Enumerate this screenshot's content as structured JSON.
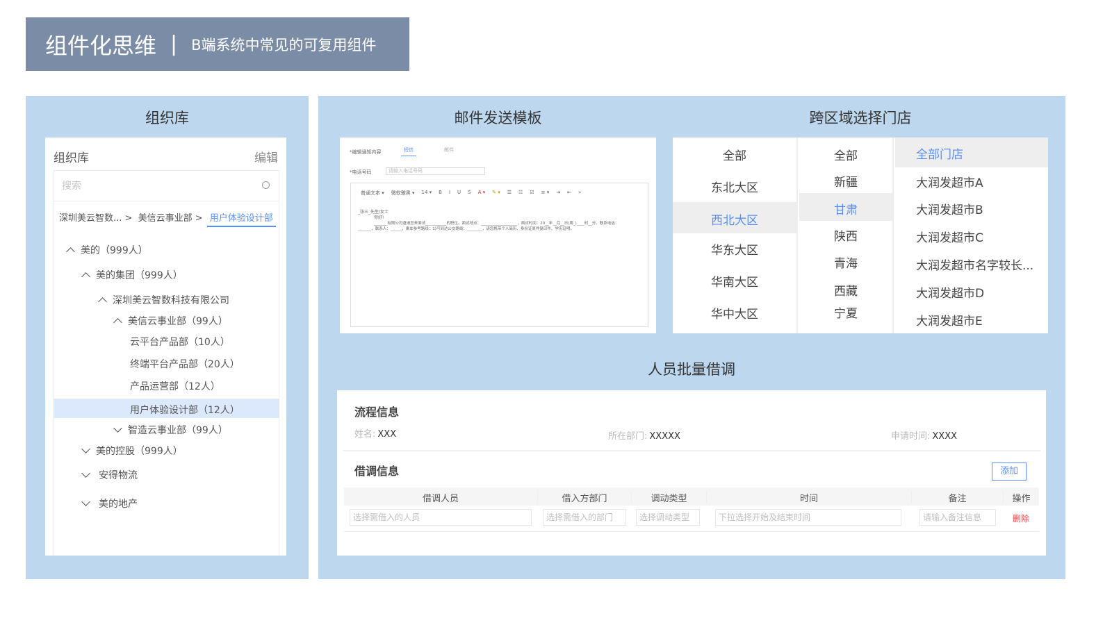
{
  "header": {
    "title": "组件化思维",
    "separator": "|",
    "subtitle": "B端系统中常见的可复用组件"
  },
  "org": {
    "section_title": "组织库",
    "card_title": "组织库",
    "edit_label": "编辑",
    "search_placeholder": "搜索",
    "breadcrumb": [
      "深圳美云智数...",
      "美信云事业部",
      "用户体验设计部"
    ],
    "tree": [
      {
        "label": "美的（999人）",
        "state": "expanded"
      },
      {
        "label": "美的集团（999人）",
        "state": "expanded"
      },
      {
        "label": "深圳美云智数科技有限公司",
        "state": "expanded"
      },
      {
        "label": "美信云事业部（99人）",
        "state": "expanded"
      },
      {
        "label": "云平台产品部（10人）",
        "state": "leaf"
      },
      {
        "label": "终端平台产品部（20人）",
        "state": "leaf"
      },
      {
        "label": "产品运营部（12人）",
        "state": "leaf"
      },
      {
        "label": "用户体验设计部（12人）",
        "state": "selected"
      },
      {
        "label": "智造云事业部（99人）",
        "state": "collapsed"
      },
      {
        "label": "美的控股（999人）",
        "state": "collapsed"
      },
      {
        "label": "安得物流",
        "state": "collapsed"
      },
      {
        "label": "美的地产",
        "state": "collapsed"
      }
    ]
  },
  "email": {
    "section_title": "邮件发送模板",
    "content_label": "*编辑通知内容",
    "tabs": [
      "短信",
      "邮件"
    ],
    "phone_label": "*电话号码",
    "phone_placeholder": "请输入电话号码",
    "toolbar": [
      "普通文本 ▾",
      "微软雅黑 ▾",
      "14 ▾",
      "B",
      "I",
      "U",
      "S",
      "A ▾",
      "✎ ▾",
      "☰",
      "☷",
      "☑",
      "≡ ▾",
      "⇥",
      "⇤",
      "»"
    ],
    "body": [
      "_张三_先生/女士",
      "你好!",
      "_______有限公司邀请您来面试___________的职位。面试地点：___________________，面试时间：20__年__月__日(周_)____时__分。联系电话：",
      "_______，联系人：______，乘车参考路线：1)可到达公交路线：________，请您携带个人简历、身份证原件复印件、学历证明。"
    ]
  },
  "region": {
    "section_title": "跨区域选择门店",
    "areas": [
      "全部",
      "东北大区",
      "西北大区",
      "华东大区",
      "华南大区",
      "华中大区"
    ],
    "selected_area": "西北大区",
    "provinces": [
      "全部",
      "新疆",
      "甘肃",
      "陕西",
      "青海",
      "西藏",
      "宁夏"
    ],
    "selected_province": "甘肃",
    "stores": [
      "全部门店",
      "大润发超市A",
      "大润发超市B",
      "大润发超市C",
      "大润发超市名字较长...",
      "大润发超市D",
      "大润发超市E"
    ],
    "selected_store": "全部门店"
  },
  "borrow": {
    "section_title": "人员批量借调",
    "process_title": "流程信息",
    "fields": [
      {
        "label": "姓名:",
        "value": "XXX"
      },
      {
        "label": "所在部门:",
        "value": "XXXXX"
      },
      {
        "label": "申请时间:",
        "value": "XXXX"
      }
    ],
    "borrow_title": "借调信息",
    "add_label": "添加",
    "columns": [
      "借调人员",
      "借入方部门",
      "调动类型",
      "时间",
      "备注",
      "操作"
    ],
    "row": {
      "person_placeholder": "选择需借入的人员",
      "dept_placeholder": "选择需借入的部门",
      "type_placeholder": "选择调动类型",
      "time_placeholder": "下拉选择开始及结束时间",
      "note_placeholder": "请输入备注信息",
      "delete_label": "删除"
    }
  }
}
